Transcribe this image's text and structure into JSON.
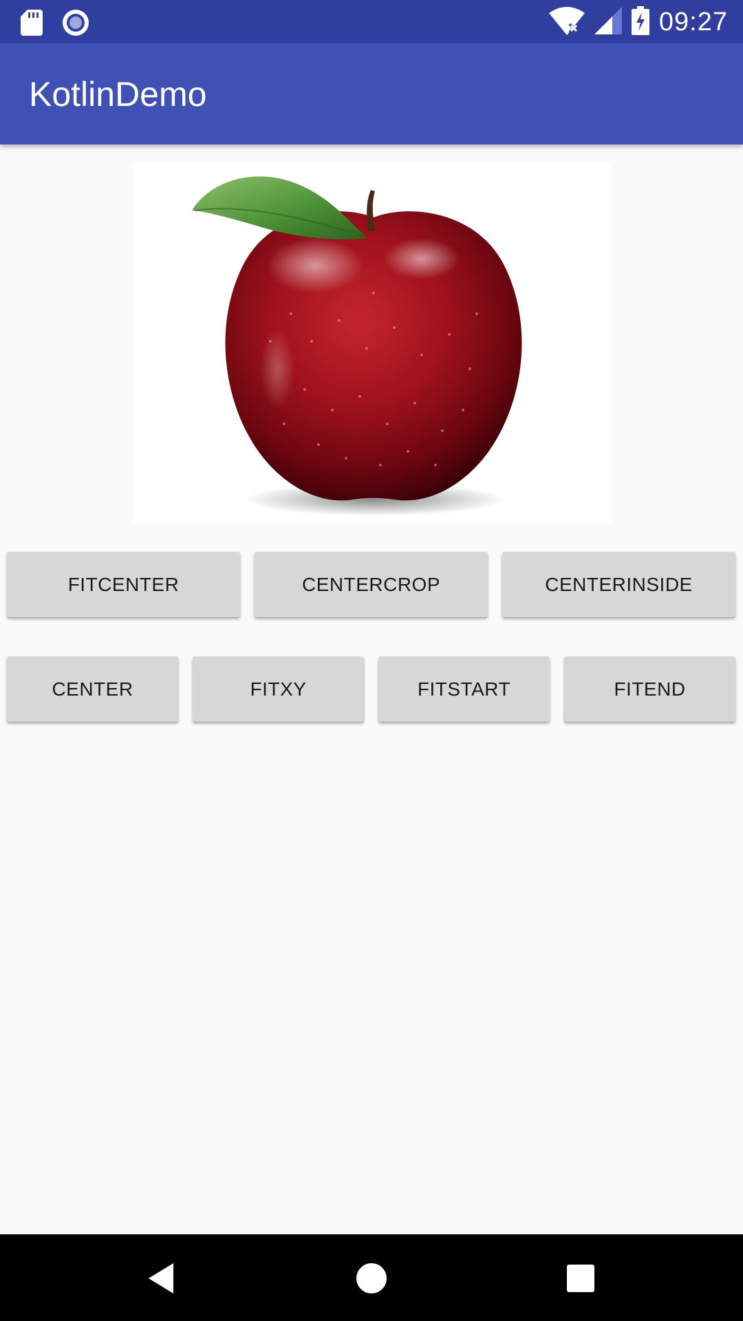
{
  "status_bar": {
    "time": "09:27",
    "icons": [
      "sd-card-icon",
      "sync-icon",
      "wifi-off-icon",
      "signal-icon",
      "battery-charging-icon"
    ]
  },
  "app_bar": {
    "title": "KotlinDemo",
    "color": "#3f51b5",
    "status_color": "#303f9f"
  },
  "image": {
    "subject": "apple-image"
  },
  "buttons_row1": [
    {
      "label": "FITCENTER"
    },
    {
      "label": "CENTERCROP"
    },
    {
      "label": "CENTERINSIDE"
    }
  ],
  "buttons_row2": [
    {
      "label": "CENTER"
    },
    {
      "label": "FITXY"
    },
    {
      "label": "FITSTART"
    },
    {
      "label": "FITEND"
    }
  ],
  "nav_bar": {
    "icons": [
      "back-icon",
      "home-icon",
      "recents-icon"
    ]
  }
}
